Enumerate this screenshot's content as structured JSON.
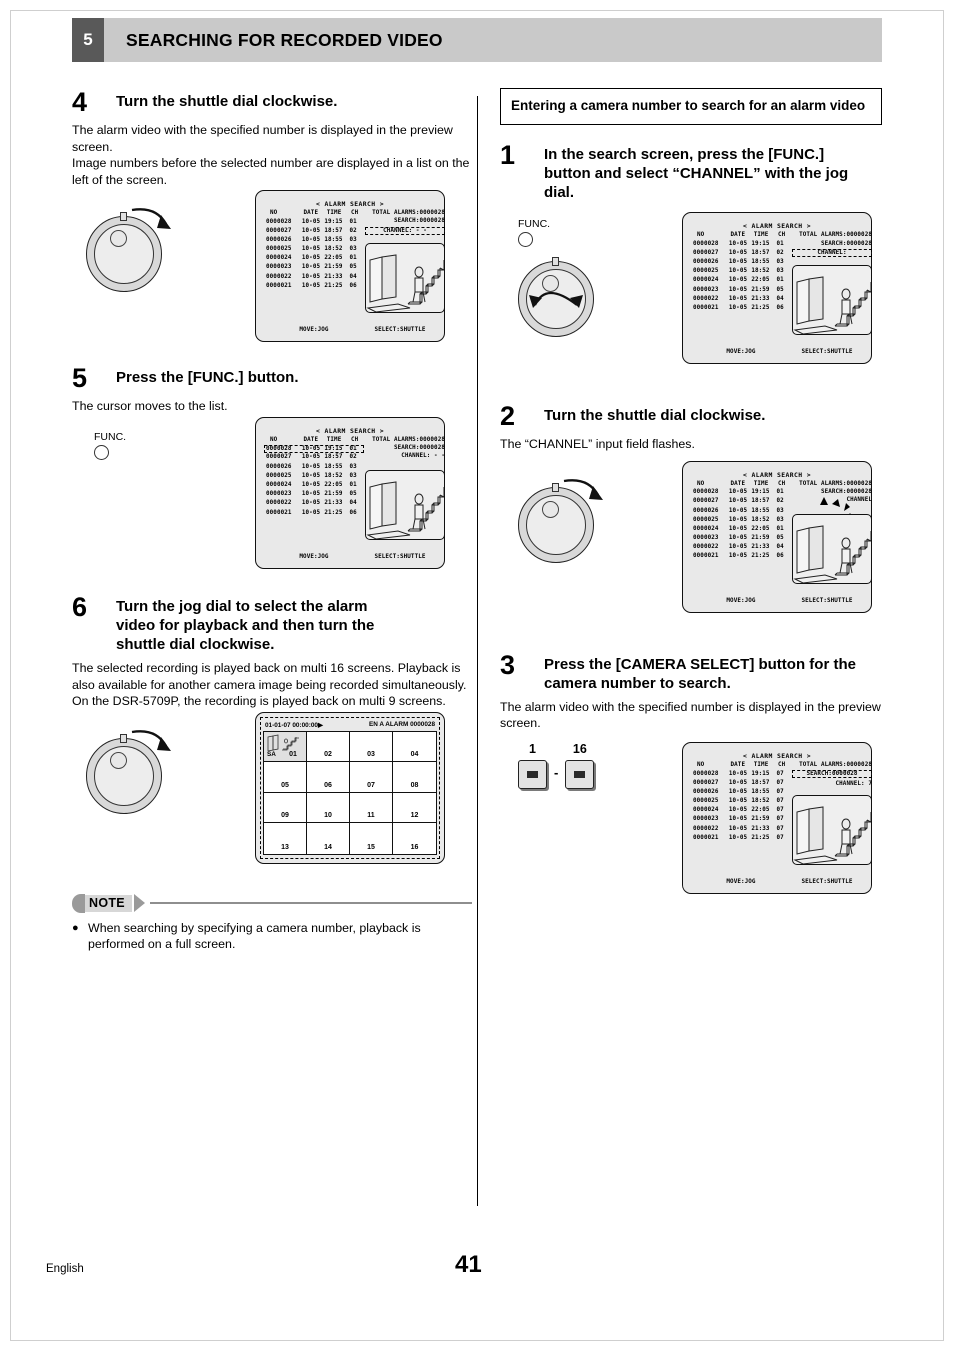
{
  "header": {
    "chapter_number": "5",
    "title": "SEARCHING FOR RECORDED VIDEO"
  },
  "footer": {
    "language": "English",
    "page_number": "41"
  },
  "labels": {
    "func": "FUNC.",
    "note": "NOTE",
    "dash": "-"
  },
  "left_column": {
    "step4": {
      "number": "4",
      "title": "Turn the shuttle dial clockwise.",
      "body_line1": "The alarm video with the specified number is displayed in the preview screen.",
      "body_line2": "Image numbers before the selected number are displayed in a list on the left of the screen."
    },
    "step5": {
      "number": "5",
      "title": "Press the [FUNC.] button.",
      "body_line1": "The cursor moves to the list."
    },
    "step6": {
      "number": "6",
      "title": "Turn the jog dial to select the alarm video for playback and then turn the shuttle dial clockwise.",
      "body_line1": "The selected recording is played back on multi 16 screens. Playback is also available for another camera image being recorded simultaneously.",
      "body_line2": "On the DSR-5709P, the recording is played back on multi 9 screens."
    },
    "note": {
      "label": "NOTE",
      "bullet": "●",
      "text": "When searching by specifying a camera number, playback is performed on a full screen."
    }
  },
  "right_column": {
    "section_title": "Entering a camera number to search for an alarm video",
    "step1": {
      "number": "1",
      "title": "In the search screen, press the [FUNC.] button and select “CHANNEL” with the jog dial."
    },
    "step2": {
      "number": "2",
      "title": "Turn the shuttle dial clockwise.",
      "body_line1": "The “CHANNEL” input field flashes."
    },
    "step3": {
      "number": "3",
      "title": "Press the [CAMERA SELECT] button for the camera number to search.",
      "body_line1": "The alarm video with the specified number is displayed in the preview screen."
    },
    "camera_buttons": {
      "first": "1",
      "last": "16",
      "separator": "-"
    }
  },
  "osd": {
    "title": "< ALARM SEARCH >",
    "columns": [
      "NO",
      "DATE",
      "TIME",
      "CH"
    ],
    "fields": {
      "total_alarms_label": "TOTAL ALARMS",
      "total_alarms_value": ":0000028",
      "search_label": "SEARCH",
      "search_value": ":0000028",
      "channel_label": "CHANNEL",
      "channel_value_blank": ": - -",
      "channel_value_empty": ":",
      "channel_value_7": ": 7"
    },
    "footer": {
      "move": "MOVE:JOG",
      "select": "SELECT:SHUTTLE"
    },
    "rows_default": [
      {
        "no": "0000028",
        "date": "10-05",
        "time": "19:15",
        "ch": "01"
      },
      {
        "no": "0000027",
        "date": "10-05",
        "time": "18:57",
        "ch": "02"
      },
      {
        "no": "0000026",
        "date": "10-05",
        "time": "18:55",
        "ch": "03"
      },
      {
        "no": "0000025",
        "date": "10-05",
        "time": "18:52",
        "ch": "03"
      },
      {
        "no": "0000024",
        "date": "10-05",
        "time": "22:05",
        "ch": "01"
      },
      {
        "no": "0000023",
        "date": "10-05",
        "time": "21:59",
        "ch": "05"
      },
      {
        "no": "0000022",
        "date": "10-05",
        "time": "21:33",
        "ch": "04"
      },
      {
        "no": "0000021",
        "date": "10-05",
        "time": "21:25",
        "ch": "06"
      }
    ],
    "rows_channel7": [
      {
        "no": "0000028",
        "date": "10-05",
        "time": "19:15",
        "ch": "07"
      },
      {
        "no": "0000027",
        "date": "10-05",
        "time": "18:57",
        "ch": "07"
      },
      {
        "no": "0000026",
        "date": "10-05",
        "time": "18:55",
        "ch": "07"
      },
      {
        "no": "0000025",
        "date": "10-05",
        "time": "18:52",
        "ch": "07"
      },
      {
        "no": "0000024",
        "date": "10-05",
        "time": "22:05",
        "ch": "07"
      },
      {
        "no": "0000023",
        "date": "10-05",
        "time": "21:59",
        "ch": "07"
      },
      {
        "no": "0000022",
        "date": "10-05",
        "time": "21:33",
        "ch": "07"
      },
      {
        "no": "0000021",
        "date": "10-05",
        "time": "21:25",
        "ch": "07"
      }
    ]
  },
  "multi_screen": {
    "timestamp": "01-01-07 00:00:00",
    "play_icon": "▶",
    "status": "EN A ALARM 0000028",
    "active_cell_label": "SA",
    "cells": [
      "01",
      "02",
      "03",
      "04",
      "05",
      "06",
      "07",
      "08",
      "09",
      "10",
      "11",
      "12",
      "13",
      "14",
      "15",
      "16"
    ]
  }
}
